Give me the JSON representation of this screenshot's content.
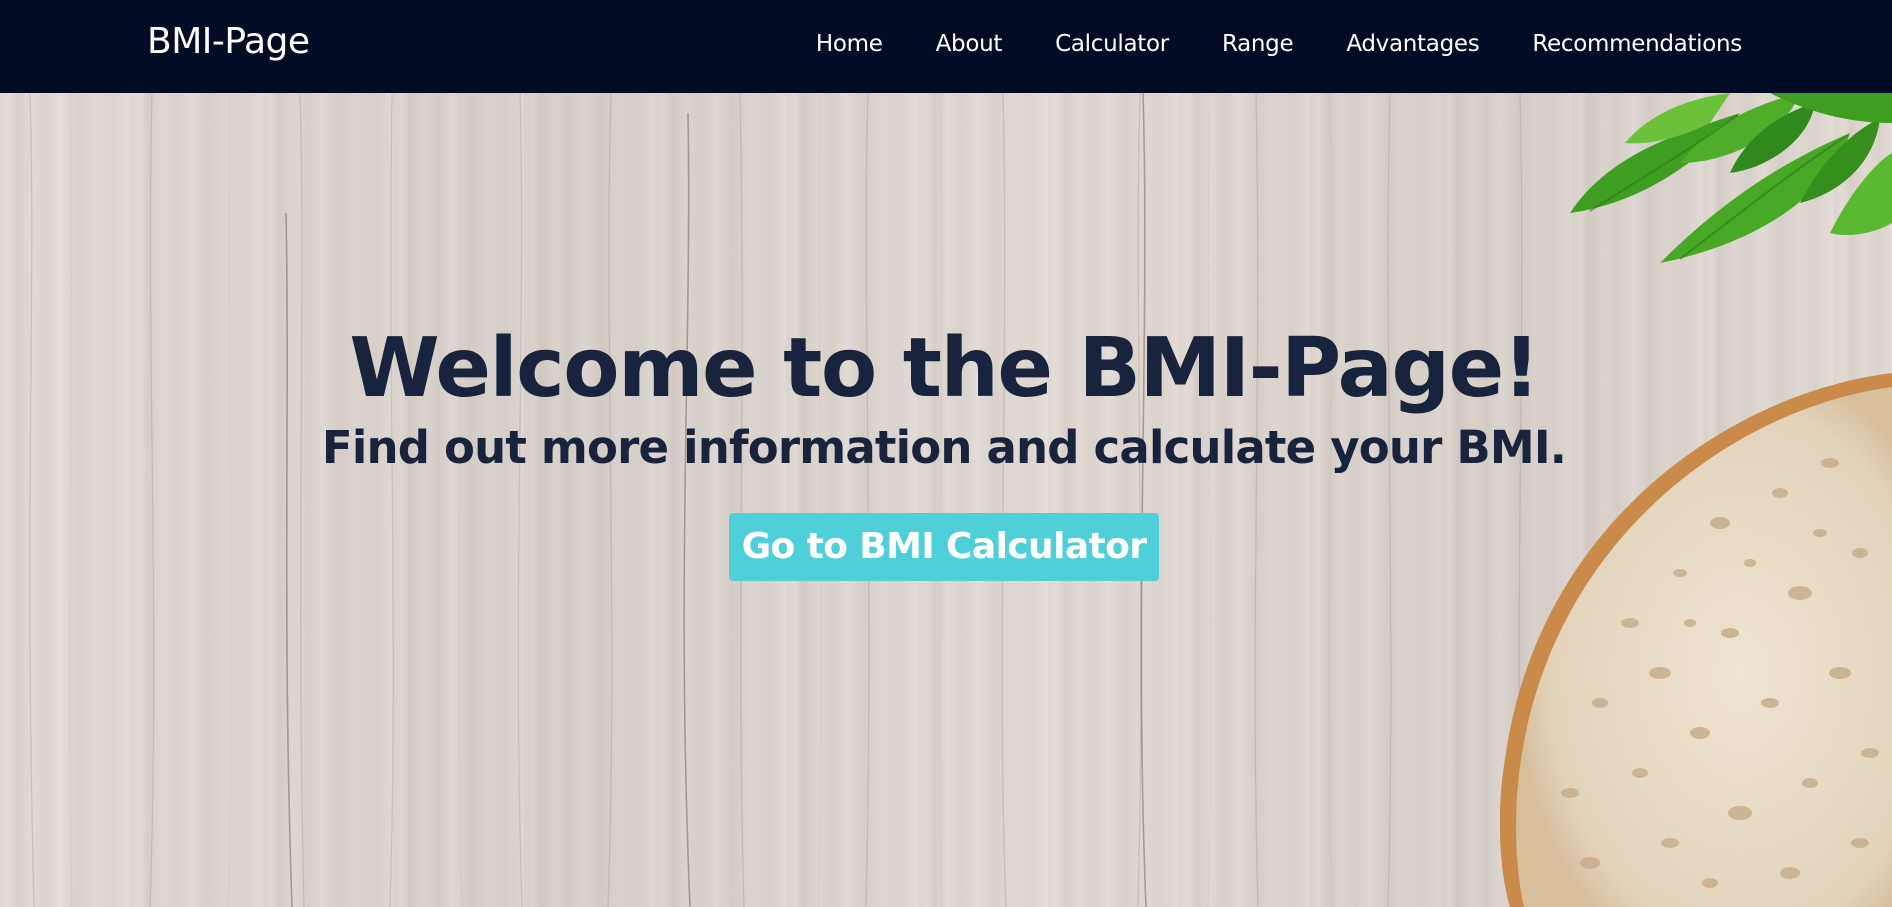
{
  "navbar": {
    "brand": "BMI-Page",
    "links": [
      "Home",
      "About",
      "Calculator",
      "Range",
      "Advantages",
      "Recommendations"
    ]
  },
  "hero": {
    "title": "Welcome to the BMI-Page!",
    "subtitle": "Find out more information and calculate your BMI.",
    "cta_label": "Go to BMI Calculator"
  },
  "colors": {
    "navbar_bg": "#020d25",
    "heading_text": "#18233d",
    "button_bg": "#4fcfd7",
    "button_text": "#ffffff",
    "background": "#dcd4cc"
  },
  "icons": {
    "leaves": "basil-leaves-decoration",
    "bread": "bread-slice-decoration"
  }
}
